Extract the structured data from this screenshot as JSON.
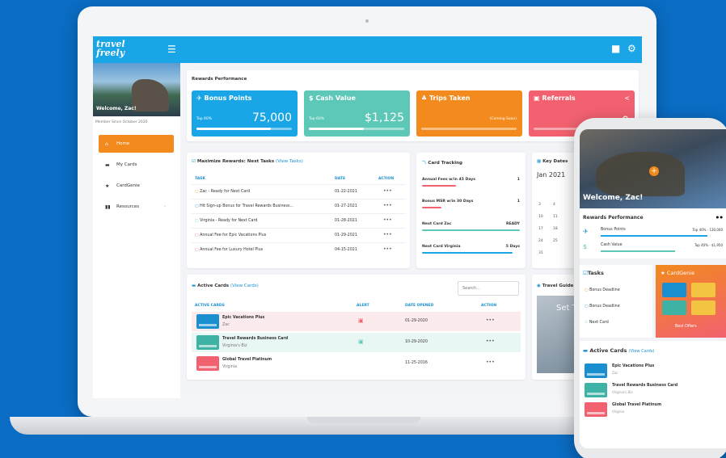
{
  "brand": {
    "logo_text": "travel freely",
    "accent": "#1aa6e6",
    "orange": "#f28a1d"
  },
  "topbar": {
    "menu_icon": "hamburger-icon",
    "chat_icon": "chat-icon",
    "settings_icon": "gear-icon"
  },
  "sidebar": {
    "welcome": "Welcome, Zac!",
    "member_since": "Member Since October 2020",
    "items": [
      {
        "label": "Home",
        "icon": "home-icon",
        "active": true
      },
      {
        "label": "My Cards",
        "icon": "card-icon",
        "active": false
      },
      {
        "label": "CardGenie",
        "icon": "star-icon",
        "active": false
      },
      {
        "label": "Resources",
        "icon": "book-icon",
        "active": false
      }
    ]
  },
  "rewards": {
    "title": "Rewards Performance",
    "cards": [
      {
        "title": "Bonus Points",
        "sub": "Top 60%",
        "value": "75,000",
        "note": "",
        "color": "#1aa6e6",
        "progress": 0.78
      },
      {
        "title": "Cash Value",
        "sub": "Top 60%",
        "value": "$1,125",
        "note": "",
        "color": "#5dc8b8",
        "progress": 0.58
      },
      {
        "title": "Trips Taken",
        "sub": "",
        "value": "",
        "note": "(Coming Soon)",
        "color": "#f28a1d",
        "progress": 0
      },
      {
        "title": "Referrals",
        "sub": "",
        "value": "0",
        "note": "",
        "color": "#f2616f",
        "progress": 0
      }
    ]
  },
  "tasks": {
    "title": "Maximize Rewards: Next Tasks",
    "view_link": "(View Tasks)",
    "headers": {
      "task": "TASK",
      "date": "DATE",
      "action": "ACTION"
    },
    "rows": [
      {
        "task": "Zac - Ready for Next Card",
        "date": "01-22-2021"
      },
      {
        "task": "Hit Sign-up Bonus for Travel Rewards Business...",
        "date": "01-27-2021"
      },
      {
        "task": "Virginia - Ready for Next Card",
        "date": "01-28-2021"
      },
      {
        "task": "Annual Fee for Epic Vacations Plus",
        "date": "01-29-2021"
      },
      {
        "task": "Annual Fee for Luxury Hotel Plus",
        "date": "04-15-2021"
      }
    ],
    "action_glyph": "•••"
  },
  "tracking": {
    "title": "Card Tracking",
    "rows": [
      {
        "label": "Annual Fees w/in 45 Days",
        "value": "1",
        "color": "#f2616f",
        "progress": 0.35
      },
      {
        "label": "Bonus MSR w/in 30 Days",
        "value": "1",
        "color": "#f2616f",
        "progress": 0.2
      },
      {
        "label": "Next Card Zac",
        "value": "READY",
        "color": "#5dc8b8",
        "progress": 1.0
      },
      {
        "label": "Next Card Virginia",
        "value": "5 Days",
        "color": "#1aa6e6",
        "progress": 0.92
      }
    ]
  },
  "calendar": {
    "title": "Key Dates",
    "month": "Jan 2021",
    "days": [
      "3",
      "4",
      "10",
      "11",
      "17",
      "18",
      "24",
      "25",
      "31"
    ]
  },
  "active_cards": {
    "title": "Active Cards",
    "view_link": "(View Cards)",
    "search_placeholder": "Search...",
    "headers": {
      "card": "ACTIVE CARDS",
      "alert": "ALERT",
      "opened": "DATE OPENED",
      "action": "ACTION"
    },
    "rows": [
      {
        "name": "Epic Vacations Plus",
        "owner": "Zac",
        "opened": "01-29-2020",
        "color": "#1a8fd0",
        "alert_color": "#f2616f",
        "highlight": "#fcebec"
      },
      {
        "name": "Travel Rewards Business Card",
        "owner": "Virginia's Biz",
        "opened": "10-29-2020",
        "color": "#3fb2a6",
        "alert_color": "#5dc8b8",
        "highlight": "#e8f6f4"
      },
      {
        "name": "Global Travel Platinum",
        "owner": "Virginia",
        "opened": "11-25-2016",
        "color": "#f2616f",
        "alert_color": "",
        "highlight": ""
      }
    ],
    "action_glyph": "•••"
  },
  "travel_guide": {
    "title": "Travel Guide",
    "overlay": "Set T"
  },
  "phone": {
    "welcome": "Welcome, Zac!",
    "rewards_title": "Rewards Performance",
    "rewards": [
      {
        "label": "Bonus Points",
        "note": "Top 40% - 130,000",
        "color": "#1aa6e6",
        "progress": 0.85
      },
      {
        "label": "Cash Value",
        "note": "Top 40% - $1,950",
        "color": "#5dc8b8",
        "progress": 0.6
      }
    ],
    "tasks_title": "Tasks",
    "tasks": [
      "Bonus Deadline",
      "Bonus Deadline",
      "Next Card"
    ],
    "cardgenie_title": "CardGenie",
    "cardgenie_link": "Best Offers",
    "cards_title": "Active Cards",
    "cards_link": "(View Cards)",
    "cards": [
      {
        "name": "Epic Vacations Plus",
        "owner": "Zac",
        "color": "#1a8fd0"
      },
      {
        "name": "Travel Rewards Business Card",
        "owner": "Virginia's Biz",
        "color": "#3fb2a6"
      },
      {
        "name": "Global Travel Platinum",
        "owner": "Virginia",
        "color": "#f2616f"
      }
    ]
  }
}
